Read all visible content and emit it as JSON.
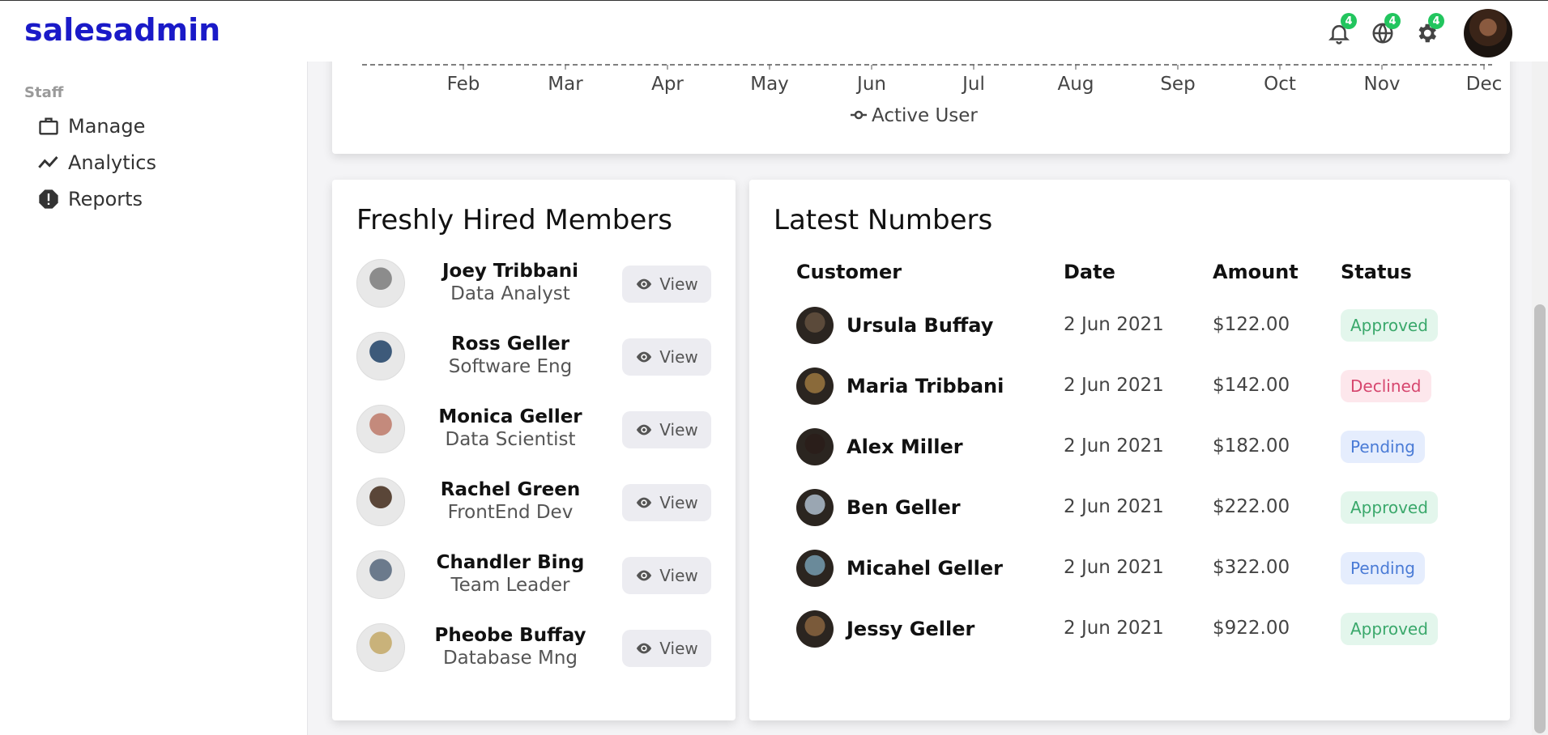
{
  "app": {
    "logo": "salesadmin"
  },
  "topbar": {
    "icons": [
      {
        "name": "bell-icon",
        "badge": "4"
      },
      {
        "name": "globe-icon",
        "badge": "4"
      },
      {
        "name": "gear-icon",
        "badge": "4"
      }
    ]
  },
  "sidebar": {
    "heading": "Staff",
    "items": [
      {
        "label": "Manage",
        "icon": "briefcase-icon"
      },
      {
        "label": "Analytics",
        "icon": "trend-icon"
      },
      {
        "label": "Reports",
        "icon": "alert-octagon-icon"
      }
    ]
  },
  "chart_data": {
    "type": "line",
    "categories": [
      "Feb",
      "Mar",
      "Apr",
      "May",
      "Jun",
      "Jul",
      "Aug",
      "Sep",
      "Oct",
      "Nov",
      "Dec"
    ],
    "legend": [
      "Active User"
    ],
    "legend_position": "bottom",
    "title": "",
    "xlabel": "",
    "ylabel": ""
  },
  "members": {
    "title": "Freshly Hired Members",
    "view_label": "View",
    "items": [
      {
        "name": "Joey Tribbani",
        "role": "Data Analyst",
        "color": "#8c8c8c"
      },
      {
        "name": "Ross Geller",
        "role": "Software Eng",
        "color": "#3d5a7a"
      },
      {
        "name": "Monica Geller",
        "role": "Data Scientist",
        "color": "#c48a7c"
      },
      {
        "name": "Rachel Green",
        "role": "FrontEnd Dev",
        "color": "#5a4638"
      },
      {
        "name": "Chandler Bing",
        "role": "Team Leader",
        "color": "#6b7a8c"
      },
      {
        "name": "Pheobe Buffay",
        "role": "Database Mng",
        "color": "#c9b27a"
      }
    ]
  },
  "numbers": {
    "title": "Latest Numbers",
    "columns": [
      "Customer",
      "Date",
      "Amount",
      "Status"
    ],
    "rows": [
      {
        "customer": "Ursula Buffay",
        "date": "2 Jun 2021",
        "amount": "$122.00",
        "status": "Approved",
        "color": "#5b4a3a"
      },
      {
        "customer": "Maria Tribbani",
        "date": "2 Jun 2021",
        "amount": "$142.00",
        "status": "Declined",
        "color": "#8a6a3a"
      },
      {
        "customer": "Alex Miller",
        "date": "2 Jun 2021",
        "amount": "$182.00",
        "status": "Pending",
        "color": "#2a1e1a"
      },
      {
        "customer": "Ben Geller",
        "date": "2 Jun 2021",
        "amount": "$222.00",
        "status": "Approved",
        "color": "#9aa6b2"
      },
      {
        "customer": "Micahel Geller",
        "date": "2 Jun 2021",
        "amount": "$322.00",
        "status": "Pending",
        "color": "#6a8a9a"
      },
      {
        "customer": "Jessy Geller",
        "date": "2 Jun 2021",
        "amount": "$922.00",
        "status": "Approved",
        "color": "#7a5a3a"
      }
    ]
  },
  "status_colors": {
    "Approved": {
      "bg": "#e3f6ec",
      "fg": "#3aa86b"
    },
    "Declined": {
      "bg": "#fde7ec",
      "fg": "#d6466e"
    },
    "Pending": {
      "bg": "#e5edfd",
      "fg": "#4a7bd6"
    }
  }
}
